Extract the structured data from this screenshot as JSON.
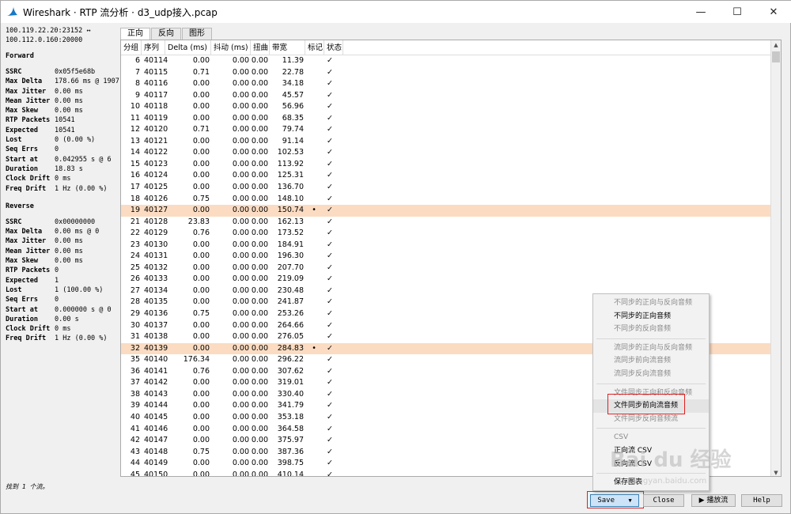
{
  "window": {
    "title": "Wireshark · RTP 流分析 · d3_udp接入.pcap",
    "min": "—",
    "max": "☐",
    "close": "✕"
  },
  "left": {
    "pair_a": "100.119.22.20:23152 ↔",
    "pair_b": "100.112.0.160:20000",
    "forward_title": "Forward",
    "forward": [
      [
        "SSRC",
        "0x05f5e68b"
      ],
      [
        "Max Delta",
        "178.66 ms @ 1907"
      ],
      [
        "Max Jitter",
        "0.00 ms"
      ],
      [
        "Mean Jitter",
        "0.00 ms"
      ],
      [
        "Max Skew",
        "0.00 ms"
      ],
      [
        "RTP Packets",
        "10541"
      ],
      [
        "Expected",
        "10541"
      ],
      [
        "Lost",
        "0 (0.00 %)"
      ],
      [
        "Seq Errs",
        "0"
      ],
      [
        "Start at",
        "0.042955 s @ 6"
      ],
      [
        "Duration",
        "18.83 s"
      ],
      [
        "Clock Drift",
        "0 ms"
      ],
      [
        "Freq Drift",
        "1 Hz (0.00 %)"
      ]
    ],
    "reverse_title": "Reverse",
    "reverse": [
      [
        "SSRC",
        "0x00000000"
      ],
      [
        "Max Delta",
        "0.00 ms @ 0"
      ],
      [
        "Max Jitter",
        "0.00 ms"
      ],
      [
        "Mean Jitter",
        "0.00 ms"
      ],
      [
        "Max Skew",
        "0.00 ms"
      ],
      [
        "RTP Packets",
        "0"
      ],
      [
        "Expected",
        "1"
      ],
      [
        "Lost",
        "1 (100.00 %)"
      ],
      [
        "Seq Errs",
        "0"
      ],
      [
        "Start at",
        "0.000000 s @ 0"
      ],
      [
        "Duration",
        "0.00 s"
      ],
      [
        "Clock Drift",
        "0 ms"
      ],
      [
        "Freq Drift",
        "1 Hz (0.00 %)"
      ]
    ],
    "status": "找到 1 个流。"
  },
  "tabs": [
    "正向",
    "反向",
    "图形"
  ],
  "columns": [
    "分组",
    "序列",
    "Delta (ms)",
    "抖动 (ms)",
    "扭曲",
    "带宽",
    "标记",
    "状态"
  ],
  "rows": [
    [
      "6",
      "40114",
      "0.00",
      "0.00",
      "0.00",
      "11.39",
      "",
      "✓"
    ],
    [
      "7",
      "40115",
      "0.71",
      "0.00",
      "0.00",
      "22.78",
      "",
      "✓"
    ],
    [
      "8",
      "40116",
      "0.00",
      "0.00",
      "0.00",
      "34.18",
      "",
      "✓"
    ],
    [
      "9",
      "40117",
      "0.00",
      "0.00",
      "0.00",
      "45.57",
      "",
      "✓"
    ],
    [
      "10",
      "40118",
      "0.00",
      "0.00",
      "0.00",
      "56.96",
      "",
      "✓"
    ],
    [
      "11",
      "40119",
      "0.00",
      "0.00",
      "0.00",
      "68.35",
      "",
      "✓"
    ],
    [
      "12",
      "40120",
      "0.71",
      "0.00",
      "0.00",
      "79.74",
      "",
      "✓"
    ],
    [
      "13",
      "40121",
      "0.00",
      "0.00",
      "0.00",
      "91.14",
      "",
      "✓"
    ],
    [
      "14",
      "40122",
      "0.00",
      "0.00",
      "0.00",
      "102.53",
      "",
      "✓"
    ],
    [
      "15",
      "40123",
      "0.00",
      "0.00",
      "0.00",
      "113.92",
      "",
      "✓"
    ],
    [
      "16",
      "40124",
      "0.00",
      "0.00",
      "0.00",
      "125.31",
      "",
      "✓"
    ],
    [
      "17",
      "40125",
      "0.00",
      "0.00",
      "0.00",
      "136.70",
      "",
      "✓"
    ],
    [
      "18",
      "40126",
      "0.75",
      "0.00",
      "0.00",
      "148.10",
      "",
      "✓"
    ],
    [
      "19",
      "40127",
      "0.00",
      "0.00",
      "0.00",
      "150.74",
      "•",
      "✓"
    ],
    [
      "21",
      "40128",
      "23.83",
      "0.00",
      "0.00",
      "162.13",
      "",
      "✓"
    ],
    [
      "22",
      "40129",
      "0.76",
      "0.00",
      "0.00",
      "173.52",
      "",
      "✓"
    ],
    [
      "23",
      "40130",
      "0.00",
      "0.00",
      "0.00",
      "184.91",
      "",
      "✓"
    ],
    [
      "24",
      "40131",
      "0.00",
      "0.00",
      "0.00",
      "196.30",
      "",
      "✓"
    ],
    [
      "25",
      "40132",
      "0.00",
      "0.00",
      "0.00",
      "207.70",
      "",
      "✓"
    ],
    [
      "26",
      "40133",
      "0.00",
      "0.00",
      "0.00",
      "219.09",
      "",
      "✓"
    ],
    [
      "27",
      "40134",
      "0.00",
      "0.00",
      "0.00",
      "230.48",
      "",
      "✓"
    ],
    [
      "28",
      "40135",
      "0.00",
      "0.00",
      "0.00",
      "241.87",
      "",
      "✓"
    ],
    [
      "29",
      "40136",
      "0.75",
      "0.00",
      "0.00",
      "253.26",
      "",
      "✓"
    ],
    [
      "30",
      "40137",
      "0.00",
      "0.00",
      "0.00",
      "264.66",
      "",
      "✓"
    ],
    [
      "31",
      "40138",
      "0.00",
      "0.00",
      "0.00",
      "276.05",
      "",
      "✓"
    ],
    [
      "32",
      "40139",
      "0.00",
      "0.00",
      "0.00",
      "284.83",
      "•",
      "✓"
    ],
    [
      "35",
      "40140",
      "176.34",
      "0.00",
      "0.00",
      "296.22",
      "",
      "✓"
    ],
    [
      "36",
      "40141",
      "0.76",
      "0.00",
      "0.00",
      "307.62",
      "",
      "✓"
    ],
    [
      "37",
      "40142",
      "0.00",
      "0.00",
      "0.00",
      "319.01",
      "",
      "✓"
    ],
    [
      "38",
      "40143",
      "0.00",
      "0.00",
      "0.00",
      "330.40",
      "",
      "✓"
    ],
    [
      "39",
      "40144",
      "0.00",
      "0.00",
      "0.00",
      "341.79",
      "",
      "✓"
    ],
    [
      "40",
      "40145",
      "0.00",
      "0.00",
      "0.00",
      "353.18",
      "",
      "✓"
    ],
    [
      "41",
      "40146",
      "0.00",
      "0.00",
      "0.00",
      "364.58",
      "",
      "✓"
    ],
    [
      "42",
      "40147",
      "0.00",
      "0.00",
      "0.00",
      "375.97",
      "",
      "✓"
    ],
    [
      "43",
      "40148",
      "0.75",
      "0.00",
      "0.00",
      "387.36",
      "",
      "✓"
    ],
    [
      "44",
      "40149",
      "0.00",
      "0.00",
      "0.00",
      "398.75",
      "",
      "✓"
    ],
    [
      "45",
      "40150",
      "0.00",
      "0.00",
      "0.00",
      "410.14",
      "",
      "✓"
    ]
  ],
  "highlight_rows": [
    13,
    25
  ],
  "highlight_color": "#fbdcc2",
  "menu": [
    {
      "label": "不同步的正向与反向音频",
      "enabled": false
    },
    {
      "label": "不同步的正向音频",
      "enabled": true
    },
    {
      "label": "不同步的反向音频",
      "enabled": false
    },
    {
      "sep": true
    },
    {
      "label": "流同步的正向与反向音频",
      "enabled": false
    },
    {
      "label": "流同步前向流音频",
      "enabled": false
    },
    {
      "label": "流同步反向流音频",
      "enabled": false
    },
    {
      "sep": true
    },
    {
      "label": "文件同步正向和反向音频",
      "enabled": false
    },
    {
      "label": "文件同步前向流音频",
      "enabled": true,
      "hover": true
    },
    {
      "label": "文件同步反向音频流",
      "enabled": false
    },
    {
      "sep": true
    },
    {
      "label": "CSV",
      "enabled": false
    },
    {
      "label": "正向流 CSV",
      "enabled": true
    },
    {
      "label": "反向流 CSV",
      "enabled": true
    },
    {
      "sep": true
    },
    {
      "label": "保存图表",
      "enabled": true
    }
  ],
  "buttons": {
    "save": "Save",
    "close": "Close",
    "play": "▶ 播放流",
    "help": "Help"
  },
  "watermark": "Bai du 经验",
  "watermark_sub": "jingyan.baidu.com"
}
